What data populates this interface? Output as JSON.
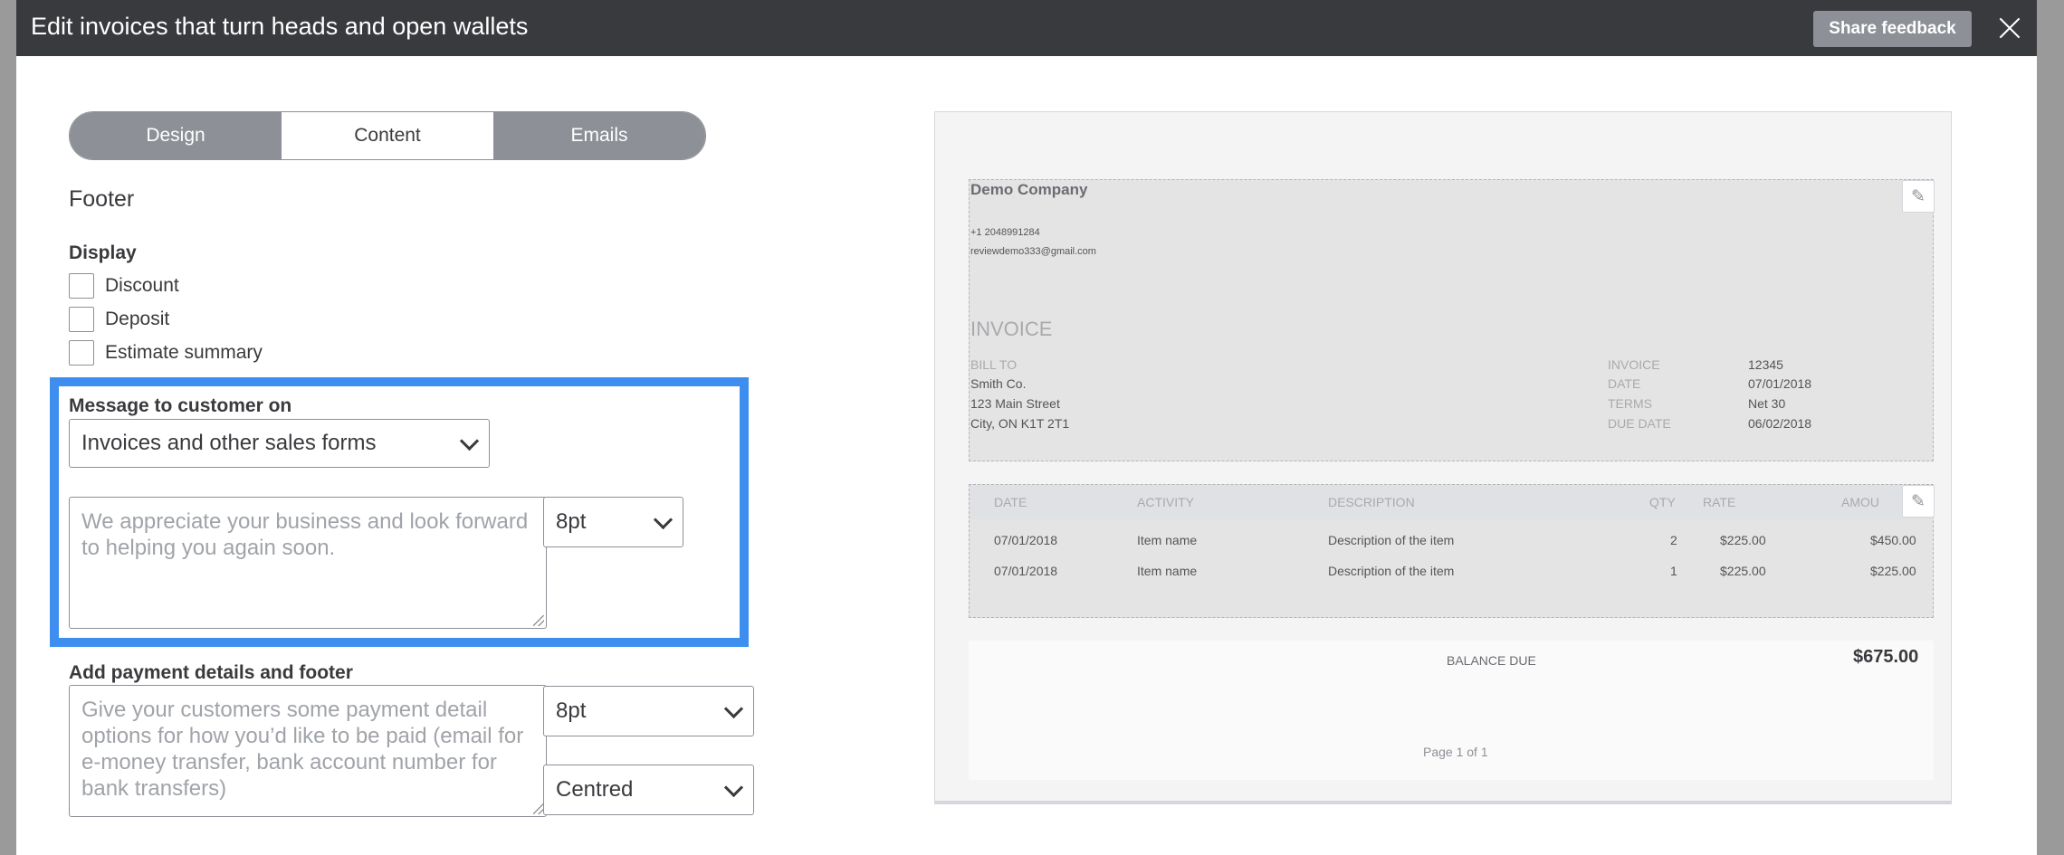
{
  "header": {
    "title": "Edit invoices that turn heads and open wallets",
    "feedback_label": "Share feedback"
  },
  "tabs": [
    {
      "label": "Design",
      "active": false
    },
    {
      "label": "Content",
      "active": true
    },
    {
      "label": "Emails",
      "active": false
    }
  ],
  "section_title": "Footer",
  "display": {
    "label": "Display",
    "options": [
      {
        "label": "Discount",
        "checked": false
      },
      {
        "label": "Deposit",
        "checked": false
      },
      {
        "label": "Estimate summary",
        "checked": false
      }
    ]
  },
  "message": {
    "label": "Message to customer on",
    "form_select": "Invoices and other sales forms",
    "placeholder": "We appreciate your business and look forward to helping you again soon.",
    "font_size": "8pt"
  },
  "payment": {
    "label": "Add payment details and footer",
    "placeholder": "Give your customers some payment detail options for how you’d like to be paid (email for e-money transfer, bank account number for bank transfers)",
    "font_size": "8pt",
    "alignment": "Centred"
  },
  "preview": {
    "company": "Demo Company",
    "phone": "+1 2048991284",
    "email": "reviewdemo333@gmail.com",
    "doc_title": "INVOICE",
    "bill_to_label": "BILL TO",
    "bill_to": [
      "Smith Co.",
      "123 Main Street",
      "City, ON K1T 2T1"
    ],
    "meta": [
      {
        "label": "INVOICE",
        "value": "12345"
      },
      {
        "label": "DATE",
        "value": "07/01/2018"
      },
      {
        "label": "TERMS",
        "value": "Net 30"
      },
      {
        "label": "DUE DATE",
        "value": "06/02/2018"
      }
    ],
    "columns": [
      "DATE",
      "ACTIVITY",
      "DESCRIPTION",
      "QTY",
      "RATE",
      "AMOU"
    ],
    "rows": [
      {
        "date": "07/01/2018",
        "activity": "Item name",
        "description": "Description of the item",
        "qty": "2",
        "rate": "$225.00",
        "amount": "$450.00"
      },
      {
        "date": "07/01/2018",
        "activity": "Item name",
        "description": "Description of the item",
        "qty": "1",
        "rate": "$225.00",
        "amount": "$225.00"
      }
    ],
    "balance_label": "BALANCE DUE",
    "balance_value": "$675.00",
    "page_label": "Page 1 of 1"
  }
}
